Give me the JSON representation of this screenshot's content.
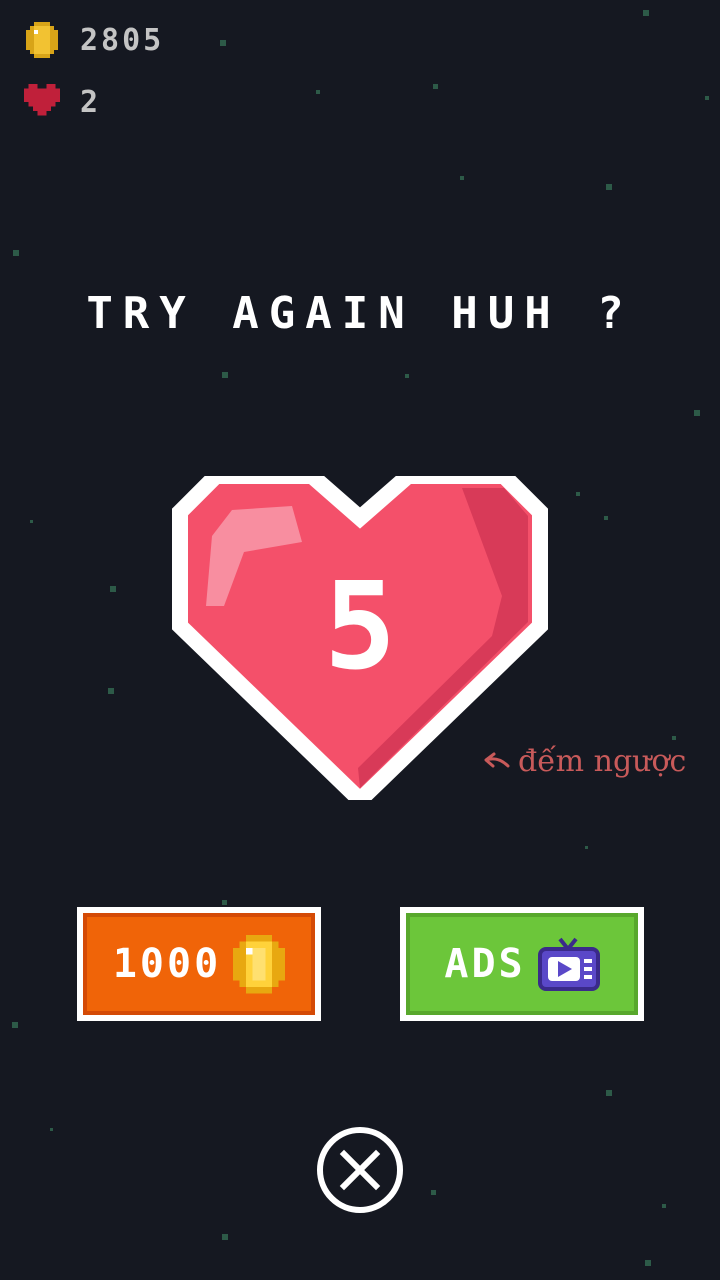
{
  "hud": {
    "coins": "2805",
    "lives": "2",
    "coin_icon": "coin-icon",
    "heart_icon": "heart-icon"
  },
  "dialog": {
    "title": "TRY AGAIN HUH ?",
    "countdown": "5"
  },
  "annotation": {
    "text": "đếm ngược"
  },
  "buttons": {
    "coins_label": "1000",
    "coins_icon": "coin-icon",
    "ads_label": "ADS",
    "ads_icon": "tv-play-icon",
    "close_icon": "close-icon"
  },
  "colors": {
    "background": "#151821",
    "heart": "#f4506a",
    "coins_button": "#f06408",
    "ads_button": "#6cc63a"
  }
}
